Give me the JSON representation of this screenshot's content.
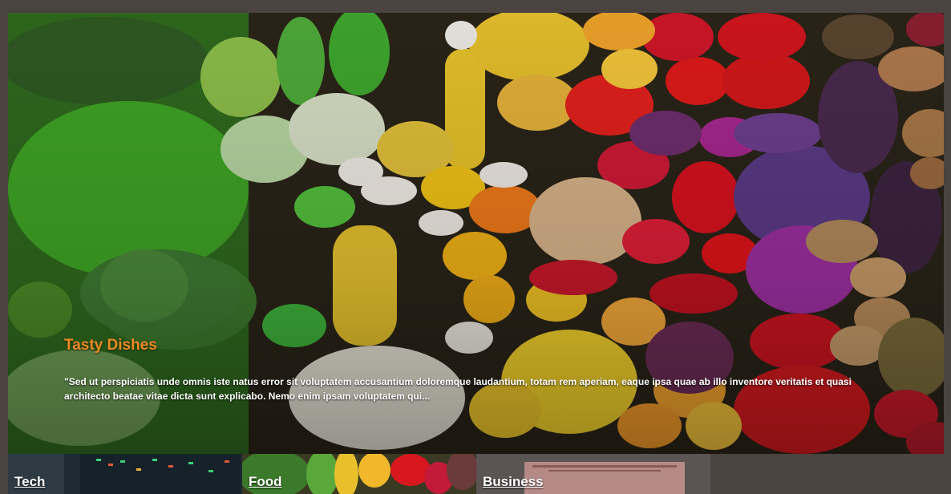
{
  "hero": {
    "image": "vegetables-fruits-photo",
    "title": "Tasty Dishes",
    "title_color": "#f08a24",
    "excerpt": "\"Sed ut perspiciatis unde omnis iste natus error sit voluptatem accusantium doloremque laudantium, totam rem aperiam, eaque ipsa quae ab illo inventore veritatis et quasi architecto beatae vitae dicta sunt explicabo. Nemo enim ipsam voluptatem qui..."
  },
  "categories": [
    {
      "label": "Tech",
      "image": "server-rack-photo"
    },
    {
      "label": "Food",
      "image": "vegetables-photo"
    },
    {
      "label": "Business",
      "image": "book-photo"
    }
  ]
}
